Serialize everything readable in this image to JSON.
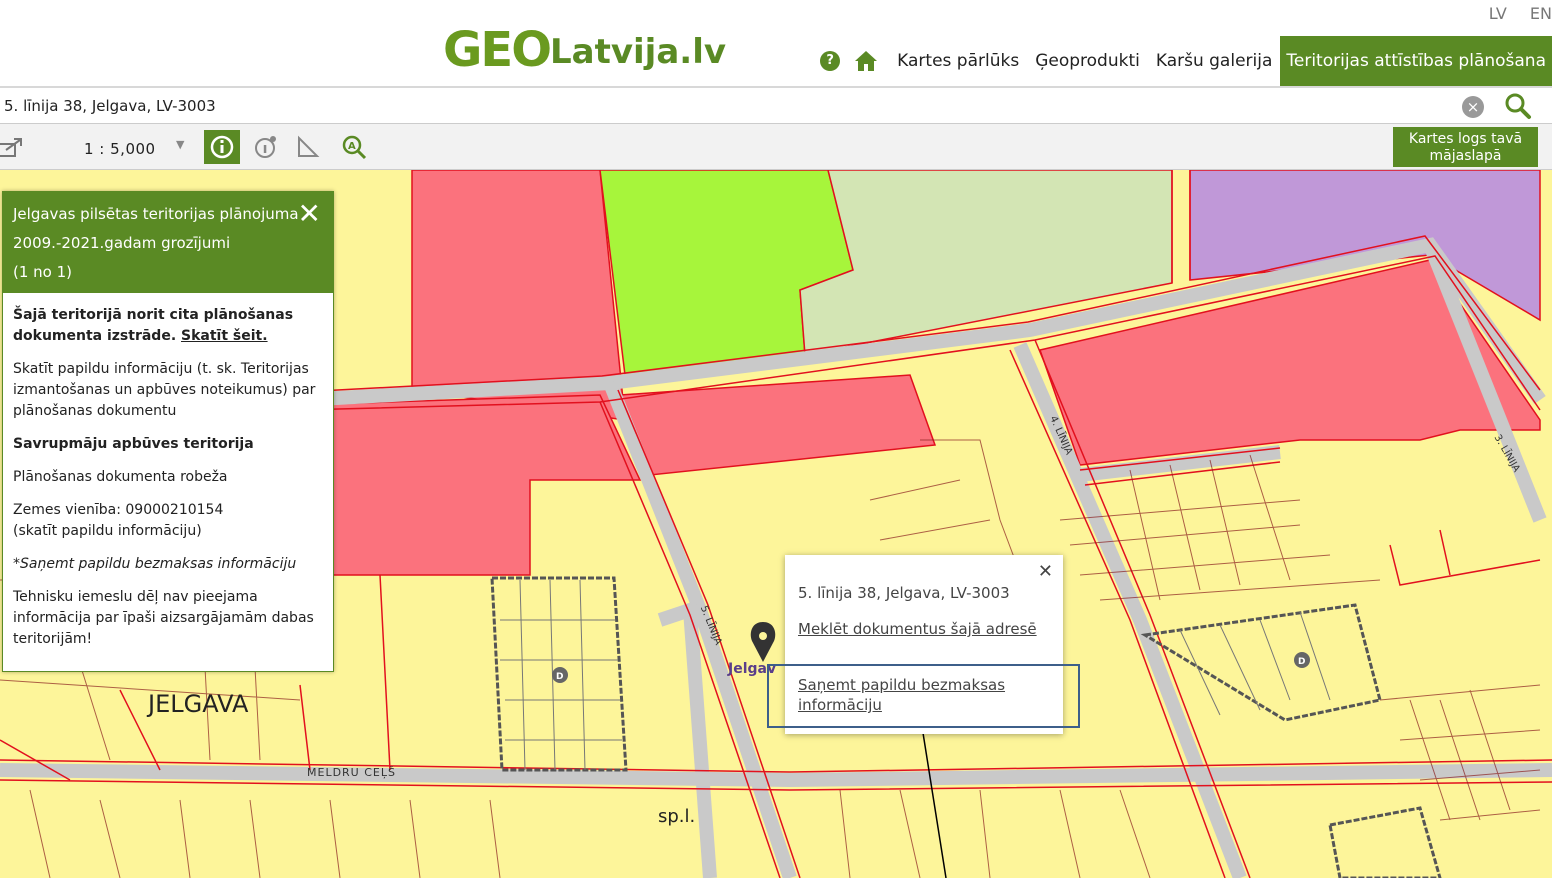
{
  "header": {
    "logo_geo": "GEO",
    "logo_rest": "Latvija.lv",
    "lang": [
      "LV",
      "EN"
    ],
    "nav": [
      "Kartes pārlūks",
      "Ģeoprodukti",
      "Karšu galerija",
      "Teritorijas attīstības plānošana"
    ]
  },
  "search": {
    "value": "5. līnija 38, Jelgava, LV-3003"
  },
  "toolbar": {
    "scale": "1 : 5,000",
    "embed_label": "Kartes logs tavā mājaslapā"
  },
  "panel": {
    "title": "Jelgavas pilsētas teritorijas plānojuma 2009.-2021.gadam grozījumi",
    "count": "(1 no 1)",
    "notice": "Šajā teritorijā norit cita plānošanas dokumenta izstrāde.",
    "notice_link": "Skatīt šeit.",
    "info": "Skatīt papildu informāciju (t. sk. Teritorijas izmantošanas un apbūves noteikumus) par plānošanas dokumentu",
    "zone": "Savrupmāju apbūves teritorija",
    "boundary": "Plānošanas dokumenta robeža",
    "parcel": "Zemes vienība: 09000210154",
    "parcel_link": "(skatīt papildu informāciju)",
    "free_info": "*Saņemt papildu bezmaksas informāciju",
    "note": "Tehnisku iemeslu dēļ nav pieejama informācija par īpaši aizsargājamām dabas teritorijām!"
  },
  "popup": {
    "address": "5. līnija 38, Jelgava, LV-3003",
    "link1": "Meklēt dokumentus šajā adresē",
    "link2": "Saņemt papildu bezmaksas informāciju"
  },
  "map": {
    "labels": {
      "city": "JELGAVA",
      "spl": "sp.l.",
      "street1": "MELDRU CEĻŠ",
      "street2": "5. LĪNIJA",
      "street3": "4. LĪNIJA",
      "street4": "3. LĪNIJA",
      "marker": "Jelgav"
    },
    "colors": {
      "residential": "#fdf59a",
      "commercial": "#fb727d",
      "green": "#a7f53b",
      "lightgreen": "#d3e5b4",
      "purple": "#c098d8",
      "road": "#d9d9d9",
      "boundary": "#e2101e"
    }
  }
}
